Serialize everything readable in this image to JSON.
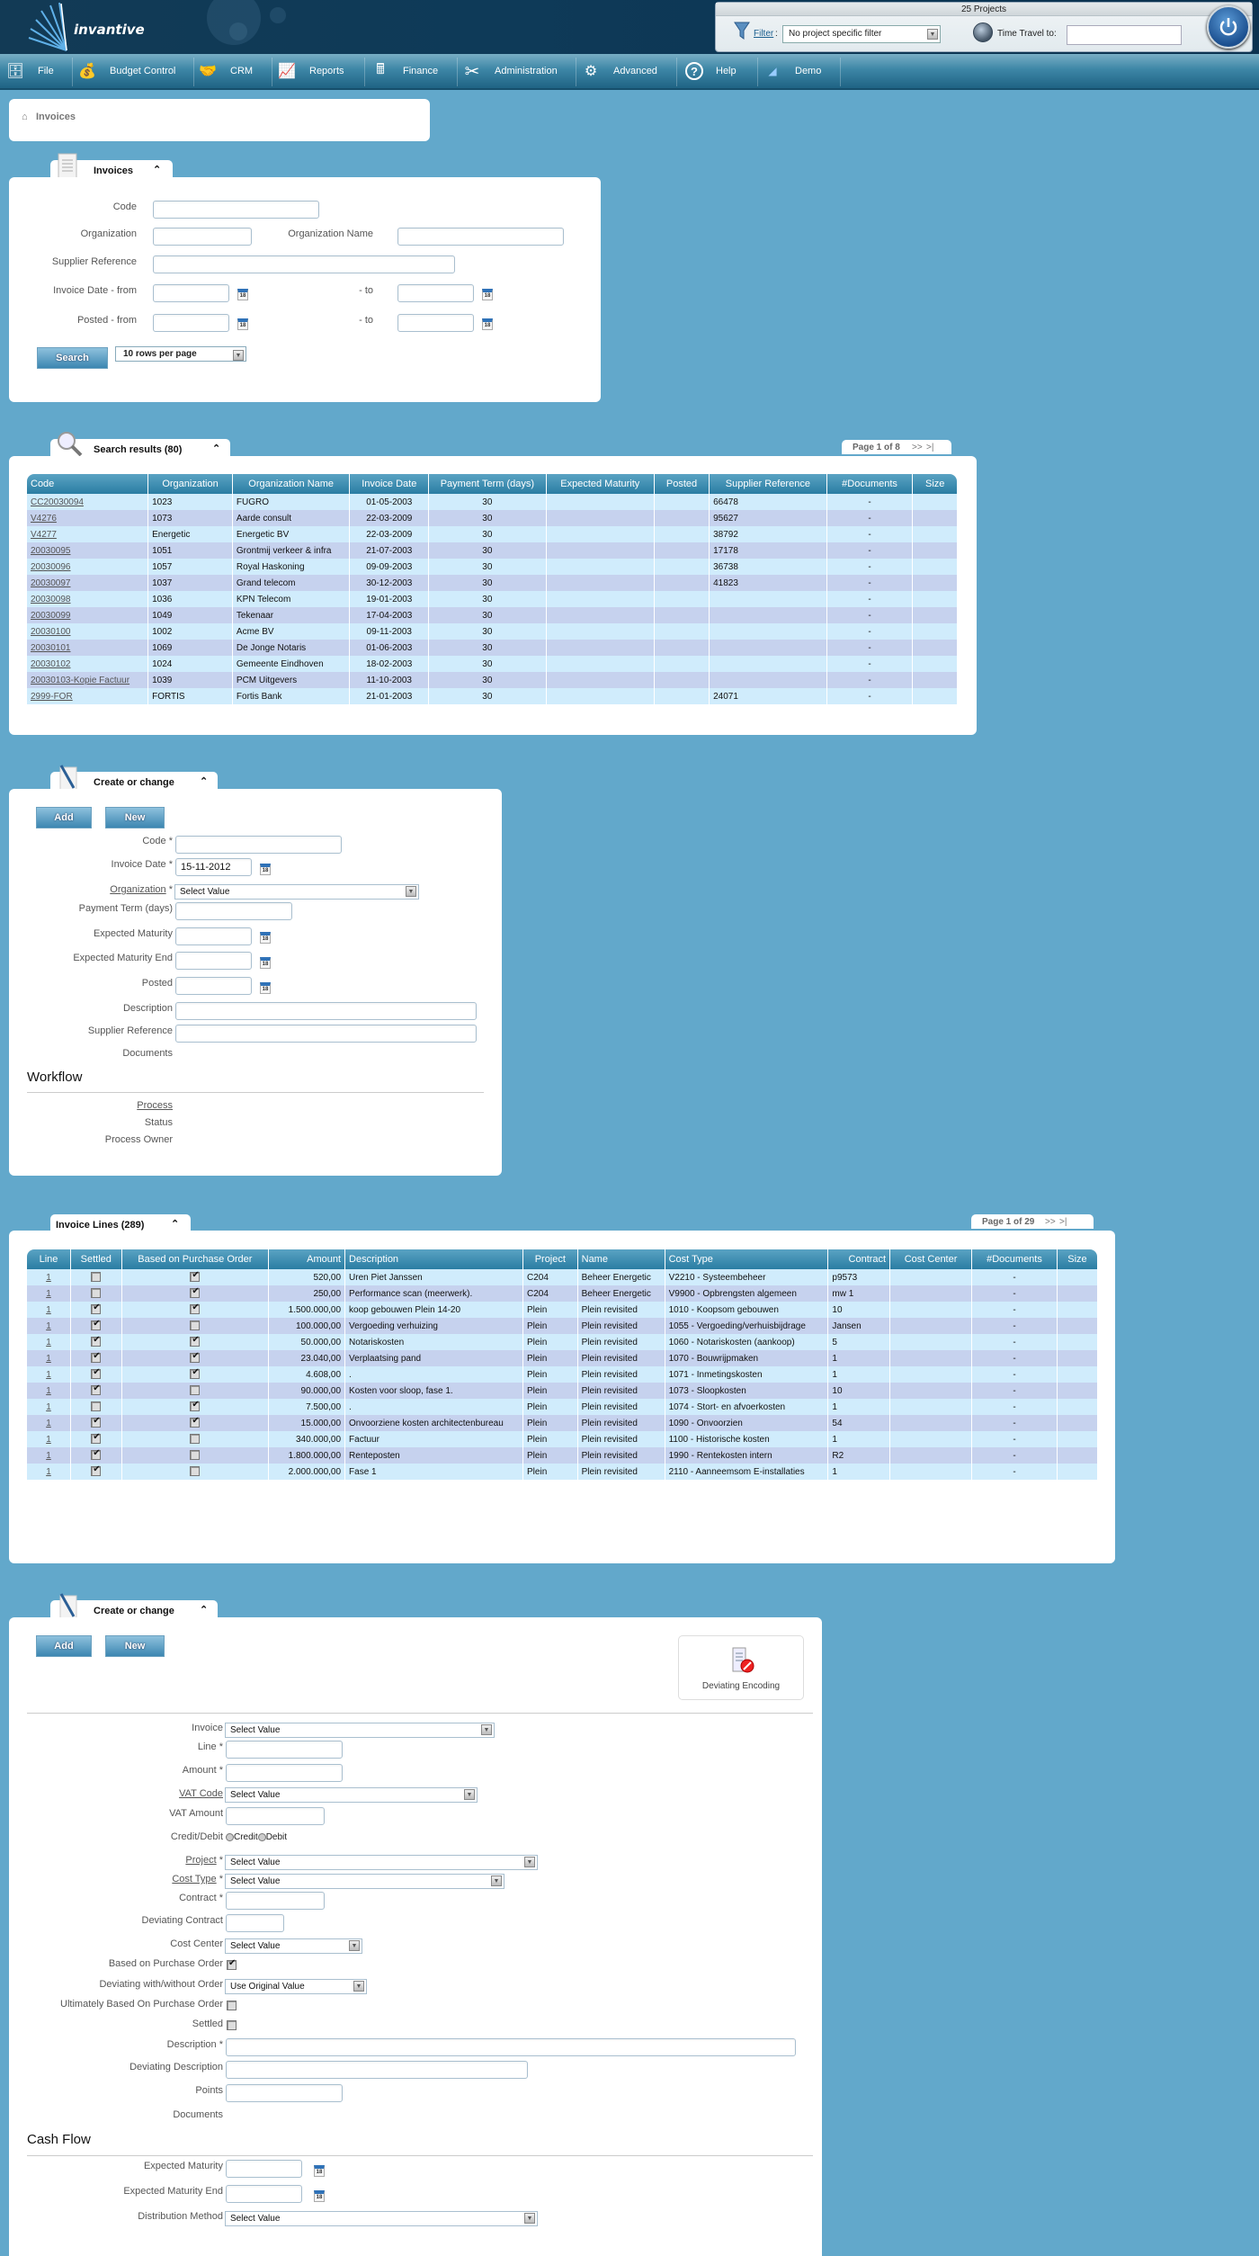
{
  "header": {
    "logo_text": "invantive",
    "projects_count": "25 Projects",
    "filter_label": "Filter",
    "filter_colon": ":",
    "filter_value": "No project specific filter",
    "time_travel_label": "Time Travel to:",
    "time_travel_value": ""
  },
  "menu": [
    {
      "label": "File",
      "icon": "cabinet-icon"
    },
    {
      "label": "Budget Control",
      "icon": "money-bag-icon"
    },
    {
      "label": "CRM",
      "icon": "handshake-icon"
    },
    {
      "label": "Reports",
      "icon": "presentation-icon"
    },
    {
      "label": "Finance",
      "icon": "calculator-icon"
    },
    {
      "label": "Administration",
      "icon": "tools-icon"
    },
    {
      "label": "Advanced",
      "icon": "gears-icon"
    },
    {
      "label": "Help",
      "icon": "help-icon"
    },
    {
      "label": "Demo",
      "icon": "demo-logo-icon"
    }
  ],
  "breadcrumb": {
    "label": "Invoices"
  },
  "search_panel": {
    "tab_title": "Invoices",
    "fields": {
      "code": {
        "label": "Code",
        "value": ""
      },
      "organization": {
        "label": "Organization",
        "value": ""
      },
      "organization_name": {
        "label": "Organization Name",
        "value": ""
      },
      "supplier_reference": {
        "label": "Supplier Reference",
        "value": ""
      },
      "invoice_date_from": {
        "label": "Invoice Date - from",
        "value": ""
      },
      "invoice_date_to": {
        "label": "- to",
        "value": ""
      },
      "posted_from": {
        "label": "Posted - from",
        "value": ""
      },
      "posted_to": {
        "label": "- to",
        "value": ""
      }
    },
    "search_button": "Search",
    "rows_per_page": "10 rows per page"
  },
  "results": {
    "tab_title": "Search results (80)",
    "pager": {
      "text": "Page 1 of 8",
      "next": ">>",
      "last": ">|"
    },
    "columns": [
      "Code",
      "Organization",
      "Organization Name",
      "Invoice Date",
      "Payment Term (days)",
      "Expected Maturity",
      "Posted",
      "Supplier Reference",
      "#Documents",
      "Size"
    ],
    "rows": [
      [
        "CC20030094",
        "1023",
        "FUGRO",
        "01-05-2003",
        "30",
        "",
        "",
        "66478",
        "-",
        ""
      ],
      [
        "V4276",
        "1073",
        "Aarde consult",
        "22-03-2009",
        "30",
        "",
        "",
        "95627",
        "-",
        ""
      ],
      [
        "V4277",
        "Energetic",
        "Energetic BV",
        "22-03-2009",
        "30",
        "",
        "",
        "38792",
        "-",
        ""
      ],
      [
        "20030095",
        "1051",
        "Grontmij verkeer & infra",
        "21-07-2003",
        "30",
        "",
        "",
        "17178",
        "-",
        ""
      ],
      [
        "20030096",
        "1057",
        "Royal Haskoning",
        "09-09-2003",
        "30",
        "",
        "",
        "36738",
        "-",
        ""
      ],
      [
        "20030097",
        "1037",
        "Grand telecom",
        "30-12-2003",
        "30",
        "",
        "",
        "41823",
        "-",
        ""
      ],
      [
        "20030098",
        "1036",
        "KPN Telecom",
        "19-01-2003",
        "30",
        "",
        "",
        "",
        "-",
        ""
      ],
      [
        "20030099",
        "1049",
        "Tekenaar",
        "17-04-2003",
        "30",
        "",
        "",
        "",
        "-",
        ""
      ],
      [
        "20030100",
        "1002",
        "Acme BV",
        "09-11-2003",
        "30",
        "",
        "",
        "",
        "-",
        ""
      ],
      [
        "20030101",
        "1069",
        "De Jonge Notaris",
        "01-06-2003",
        "30",
        "",
        "",
        "",
        "-",
        ""
      ],
      [
        "20030102",
        "1024",
        "Gemeente Eindhoven",
        "18-02-2003",
        "30",
        "",
        "",
        "",
        "-",
        ""
      ],
      [
        "20030103-Kopie Factuur",
        "1039",
        "PCM Uitgevers",
        "11-10-2003",
        "30",
        "",
        "",
        "",
        "-",
        ""
      ],
      [
        "2999-FOR",
        "FORTIS",
        "Fortis Bank",
        "21-01-2003",
        "30",
        "",
        "",
        "24071",
        "-",
        ""
      ]
    ]
  },
  "invoice_form": {
    "tab_title": "Create or change",
    "add_button": "Add",
    "new_button": "New",
    "fields": {
      "code": {
        "label": "Code *",
        "value": ""
      },
      "invoice_date": {
        "label": "Invoice Date *",
        "value": "15-11-2012"
      },
      "organization": {
        "label": "Organization",
        "required": " *",
        "value": "Select Value"
      },
      "payment_term": {
        "label": "Payment Term (days)",
        "value": ""
      },
      "expected_maturity": {
        "label": "Expected Maturity",
        "value": ""
      },
      "expected_maturity_end": {
        "label": "Expected Maturity End",
        "value": ""
      },
      "posted": {
        "label": "Posted",
        "value": ""
      },
      "description": {
        "label": "Description",
        "value": ""
      },
      "supplier_reference": {
        "label": "Supplier Reference",
        "value": ""
      },
      "documents": {
        "label": "Documents"
      }
    },
    "workflow": {
      "heading": "Workflow",
      "process": "Process",
      "status": "Status",
      "process_owner": "Process Owner"
    }
  },
  "lines": {
    "tab_title": "Invoice Lines (289)",
    "pager": {
      "text": "Page 1 of 29",
      "next": ">>",
      "last": ">|"
    },
    "columns": [
      "Line",
      "Settled",
      "Based on Purchase Order",
      "Amount",
      "Description",
      "Project",
      "Name",
      "Cost Type",
      "Contract",
      "Cost Center",
      "#Documents",
      "Size"
    ],
    "rows": [
      {
        "line": "1",
        "settled": false,
        "po": true,
        "amount": "520,00",
        "description": "Uren Piet Janssen",
        "project": "C204",
        "name": "Beheer Energetic",
        "cost_type": "V2210 - Systeembeheer",
        "contract": "p9573",
        "cost_center": "",
        "docs": "-",
        "size": ""
      },
      {
        "line": "1",
        "settled": false,
        "po": true,
        "amount": "250,00",
        "description": "Performance scan (meerwerk).",
        "project": "C204",
        "name": "Beheer Energetic",
        "cost_type": "V9900 - Opbrengsten algemeen",
        "contract": "mw 1",
        "cost_center": "",
        "docs": "-",
        "size": ""
      },
      {
        "line": "1",
        "settled": true,
        "po": true,
        "amount": "1.500.000,00",
        "description": "koop gebouwen Plein 14-20",
        "project": "Plein",
        "name": "Plein revisited",
        "cost_type": "1010 - Koopsom gebouwen",
        "contract": "10",
        "cost_center": "",
        "docs": "-",
        "size": ""
      },
      {
        "line": "1",
        "settled": true,
        "po": false,
        "amount": "100.000,00",
        "description": "Vergoeding verhuizing",
        "project": "Plein",
        "name": "Plein revisited",
        "cost_type": "1055 - Vergoeding/verhuisbijdrage",
        "contract": "Jansen",
        "cost_center": "",
        "docs": "-",
        "size": ""
      },
      {
        "line": "1",
        "settled": true,
        "po": true,
        "amount": "50.000,00",
        "description": "Notariskosten",
        "project": "Plein",
        "name": "Plein revisited",
        "cost_type": "1060 - Notariskosten (aankoop)",
        "contract": "5",
        "cost_center": "",
        "docs": "-",
        "size": ""
      },
      {
        "line": "1",
        "settled": true,
        "po": true,
        "amount": "23.040,00",
        "description": "Verplaatsing pand",
        "project": "Plein",
        "name": "Plein revisited",
        "cost_type": "1070 - Bouwrijpmaken",
        "contract": "1",
        "cost_center": "",
        "docs": "-",
        "size": ""
      },
      {
        "line": "1",
        "settled": true,
        "po": true,
        "amount": "4.608,00",
        "description": ".",
        "project": "Plein",
        "name": "Plein revisited",
        "cost_type": "1071 - Inmetingskosten",
        "contract": "1",
        "cost_center": "",
        "docs": "-",
        "size": ""
      },
      {
        "line": "1",
        "settled": true,
        "po": false,
        "amount": "90.000,00",
        "description": "Kosten voor sloop, fase 1.",
        "project": "Plein",
        "name": "Plein revisited",
        "cost_type": "1073 - Sloopkosten",
        "contract": "10",
        "cost_center": "",
        "docs": "-",
        "size": ""
      },
      {
        "line": "1",
        "settled": false,
        "po": true,
        "amount": "7.500,00",
        "description": ".",
        "project": "Plein",
        "name": "Plein revisited",
        "cost_type": "1074 - Stort- en afvoerkosten",
        "contract": "1",
        "cost_center": "",
        "docs": "-",
        "size": ""
      },
      {
        "line": "1",
        "settled": true,
        "po": true,
        "amount": "15.000,00",
        "description": "Onvoorziene kosten architectenbureau",
        "project": "Plein",
        "name": "Plein revisited",
        "cost_type": "1090 - Onvoorzien",
        "contract": "54",
        "cost_center": "",
        "docs": "-",
        "size": ""
      },
      {
        "line": "1",
        "settled": true,
        "po": false,
        "amount": "340.000,00",
        "description": "Factuur",
        "project": "Plein",
        "name": "Plein revisited",
        "cost_type": "1100 - Historische kosten",
        "contract": "1",
        "cost_center": "",
        "docs": "-",
        "size": ""
      },
      {
        "line": "1",
        "settled": true,
        "po": false,
        "amount": "1.800.000,00",
        "description": "Renteposten",
        "project": "Plein",
        "name": "Plein revisited",
        "cost_type": "1990 - Rentekosten intern",
        "contract": "R2",
        "cost_center": "",
        "docs": "-",
        "size": ""
      },
      {
        "line": "1",
        "settled": true,
        "po": false,
        "amount": "2.000.000,00",
        "description": "Fase 1",
        "project": "Plein",
        "name": "Plein revisited",
        "cost_type": "2110 - Aanneemsom E-installaties",
        "contract": "1",
        "cost_center": "",
        "docs": "-",
        "size": ""
      }
    ]
  },
  "line_form": {
    "tab_title": "Create or change",
    "add_button": "Add",
    "new_button": "New",
    "deviating_encoding": "Deviating Encoding",
    "fields": {
      "invoice": {
        "label": "Invoice",
        "value": "Select Value"
      },
      "line": {
        "label": "Line *",
        "value": ""
      },
      "amount": {
        "label": "Amount *",
        "value": ""
      },
      "vat_code": {
        "label": "VAT Code",
        "value": "Select Value"
      },
      "vat_amount": {
        "label": "VAT Amount",
        "value": ""
      },
      "credit_debit": {
        "label": "Credit/Debit",
        "credit": "Credit",
        "debit": "Debit"
      },
      "project": {
        "label": "Project",
        "required": " *",
        "value": "Select Value"
      },
      "cost_type": {
        "label": "Cost Type",
        "required": " *",
        "value": "Select Value"
      },
      "contract": {
        "label": "Contract *",
        "value": ""
      },
      "deviating_contract": {
        "label": "Deviating Contract",
        "value": ""
      },
      "cost_center": {
        "label": "Cost Center",
        "value": "Select Value"
      },
      "based_on_po": {
        "label": "Based on Purchase Order",
        "checked": true
      },
      "deviating_order": {
        "label": "Deviating with/without Order",
        "value": "Use Original Value"
      },
      "ultimately_po": {
        "label": "Ultimately Based On Purchase Order",
        "checked": false
      },
      "settled": {
        "label": "Settled",
        "checked": false
      },
      "description": {
        "label": "Description *",
        "value": ""
      },
      "deviating_description": {
        "label": "Deviating Description",
        "value": ""
      },
      "points": {
        "label": "Points",
        "value": ""
      },
      "documents": {
        "label": "Documents"
      }
    },
    "cash_flow": {
      "heading": "Cash Flow",
      "expected_maturity": {
        "label": "Expected Maturity",
        "value": ""
      },
      "expected_maturity_end": {
        "label": "Expected Maturity End",
        "value": ""
      },
      "distribution_method": {
        "label": "Distribution Method",
        "value": "Select Value"
      }
    }
  }
}
